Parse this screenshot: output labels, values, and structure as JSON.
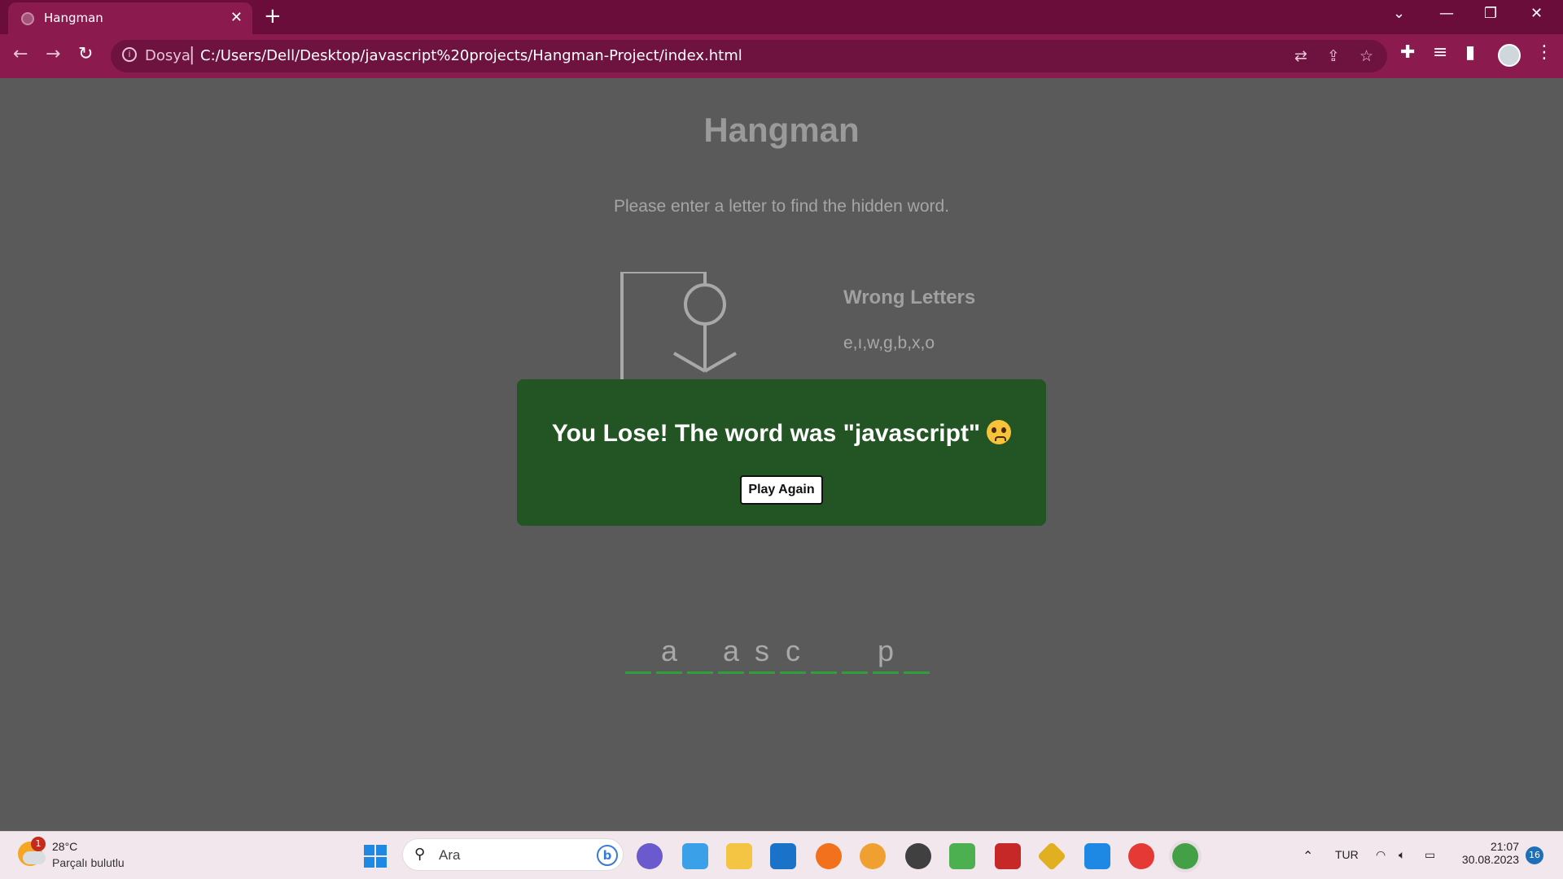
{
  "browser": {
    "tab_title": "Hangman",
    "tab_close": "✕",
    "new_tab": "+",
    "scheme_label": "Dosya",
    "url": "C:/Users/Dell/Desktop/javascript%20projects/Hangman-Project/index.html"
  },
  "game": {
    "title": "Hangman",
    "subtitle": "Please enter a letter to find the hidden word.",
    "wrong_title": "Wrong Letters",
    "wrong_letters": "e,ı,w,g,b,x,o",
    "word_slots": [
      "",
      "a",
      "",
      "a",
      "s",
      "c",
      "",
      "",
      "p",
      ""
    ],
    "popup": {
      "message": "You Lose! The word was \"javascript\"",
      "button": "Play Again"
    },
    "colors": {
      "popup_bg": "#235423",
      "slot_underline": "#2e9f3a"
    }
  },
  "taskbar": {
    "weather_badge": "1",
    "temperature": "28°C",
    "weather_desc": "Parçalı bulutlu",
    "search_label": "Ara",
    "language": "TUR",
    "time": "21:07",
    "date": "30.08.2023",
    "notifications": "16"
  }
}
